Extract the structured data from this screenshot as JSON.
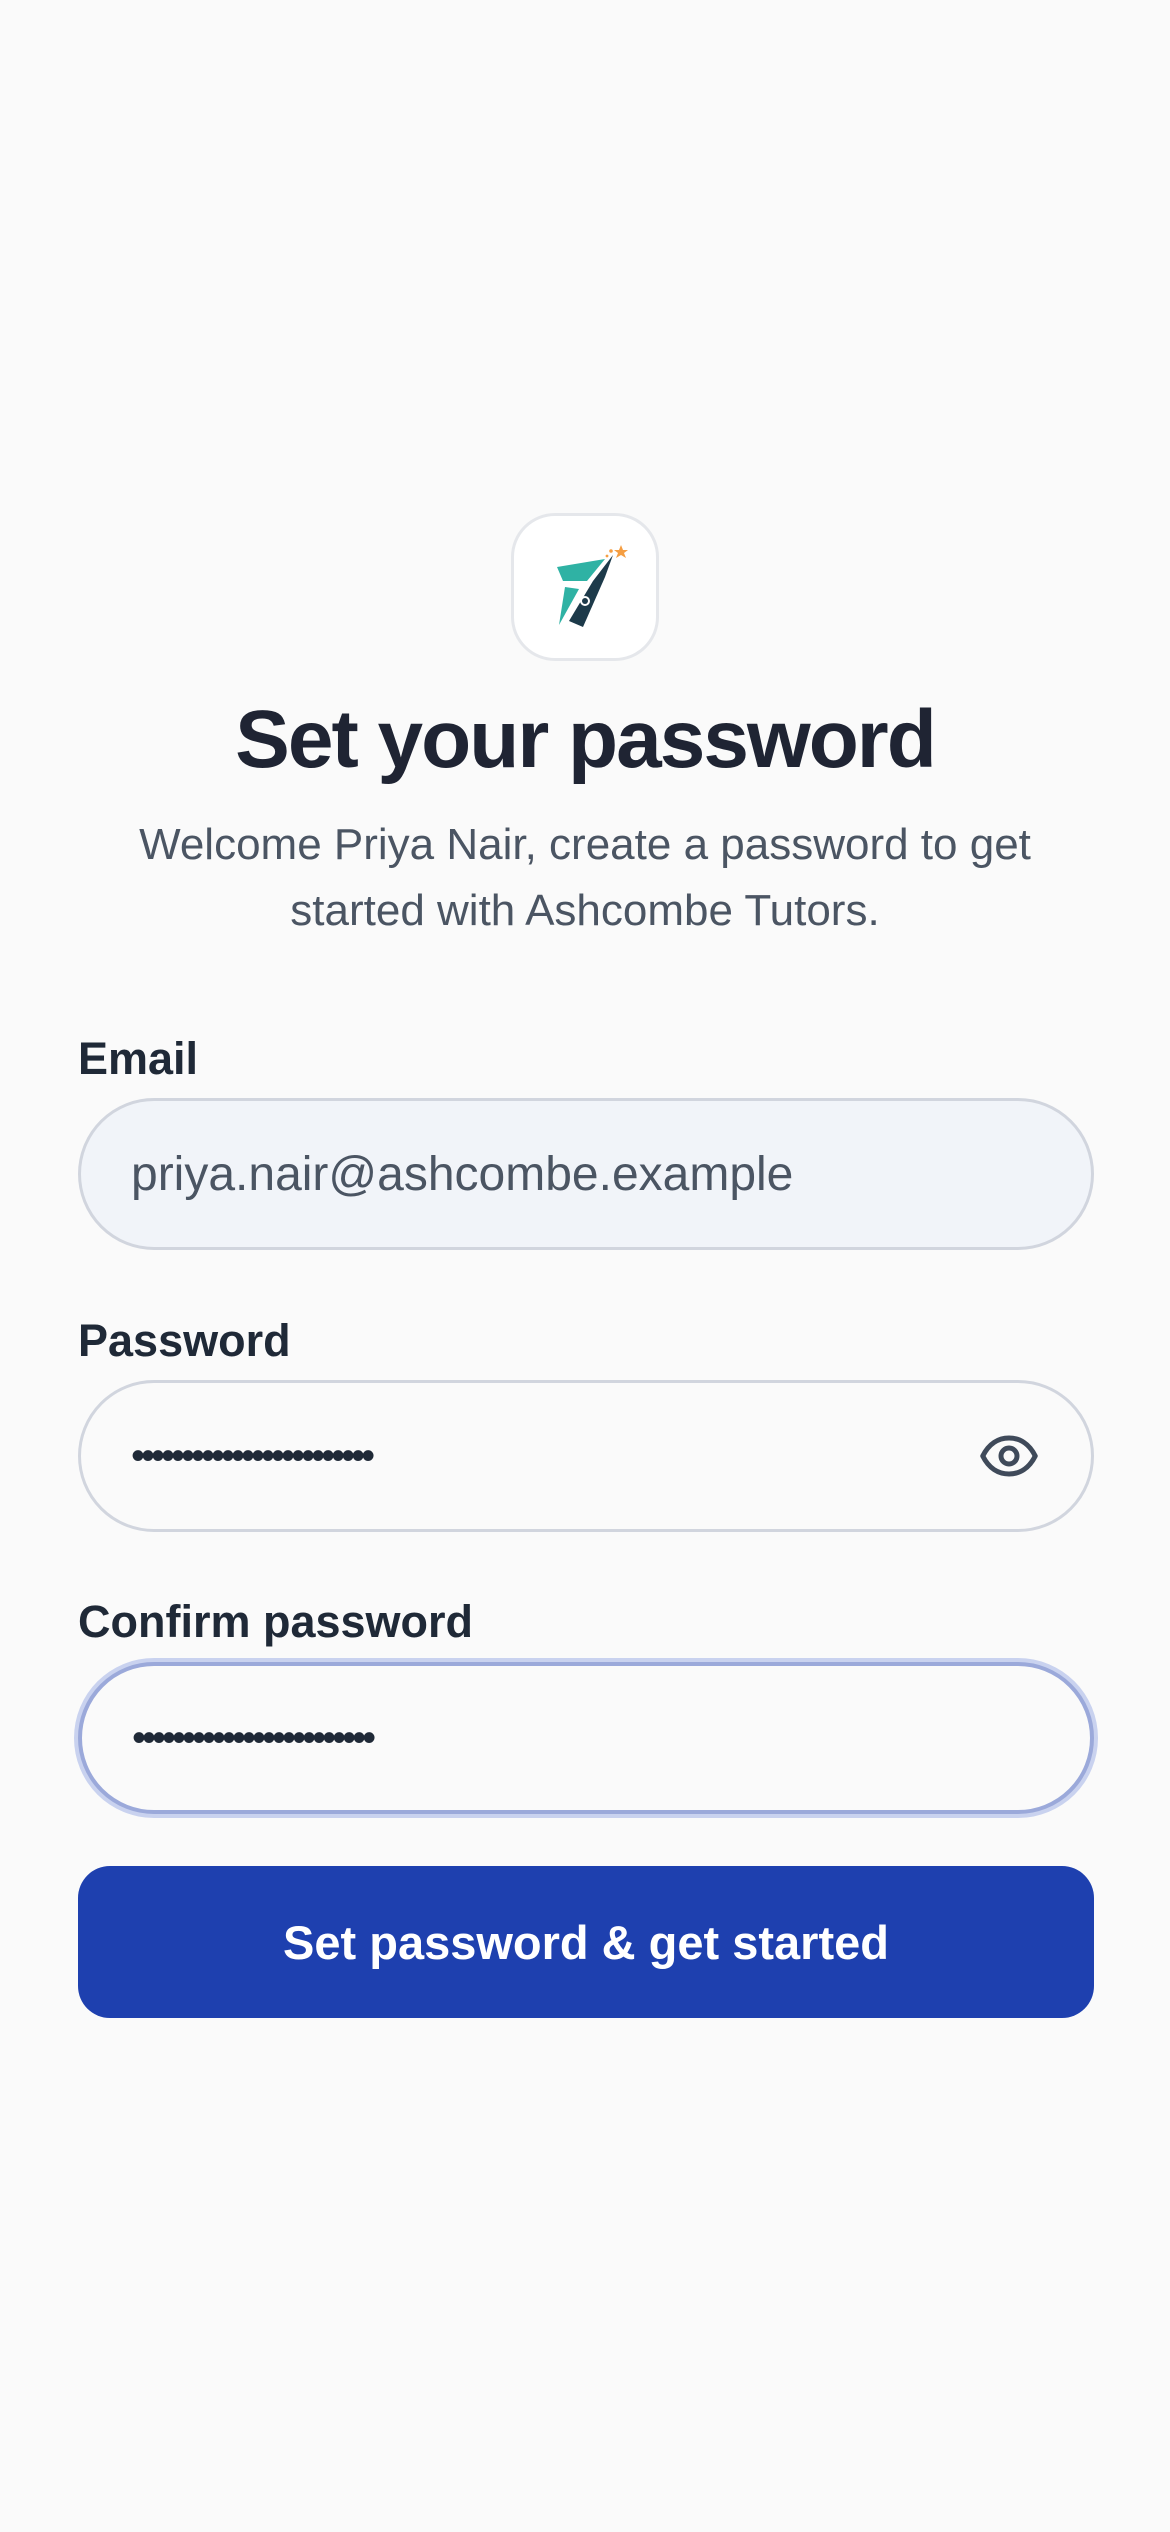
{
  "header": {
    "logo_icon": "pen-nib-star-logo",
    "title": "Set your password",
    "subtitle": "Welcome Priya Nair, create a password to get started with Ashcombe Tutors."
  },
  "form": {
    "email": {
      "label": "Email",
      "value": "priya.nair@ashcombe.example"
    },
    "password": {
      "label": "Password",
      "masked_value": "••••••••••••••••••••••••",
      "toggle_icon": "eye-icon"
    },
    "confirm_password": {
      "label": "Confirm password",
      "masked_value": "••••••••••••••••••••••••"
    },
    "submit_label": "Set password & get started"
  },
  "colors": {
    "accent": "#1e40af",
    "logo_teal": "#2fb2a4",
    "logo_dark": "#1d3a4a",
    "logo_star": "#f59e42"
  }
}
